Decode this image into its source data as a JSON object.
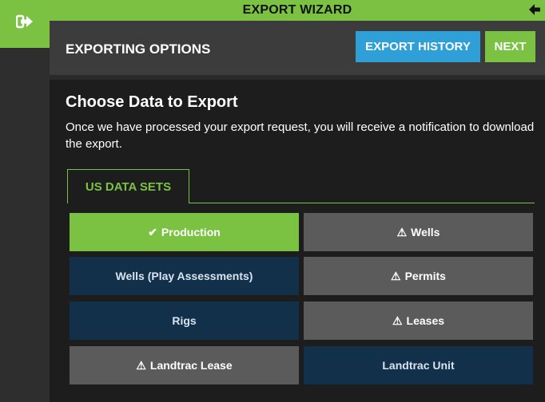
{
  "wizard": {
    "title": "EXPORT WIZARD",
    "back_glyph": "🡐"
  },
  "header": {
    "title": "EXPORTING OPTIONS",
    "export_history_label": "EXPORT HISTORY",
    "next_label": "NEXT"
  },
  "content": {
    "heading": "Choose Data to Export",
    "description": "Once we have processed your export request, you will receive a notification to download the export.",
    "tab_label": "US DATA SETS"
  },
  "datasets": [
    {
      "label": "Production",
      "state": "selected",
      "icon": "check-icon"
    },
    {
      "label": "Wells",
      "state": "warning",
      "icon": "warning-icon"
    },
    {
      "label": "Wells (Play Assessments)",
      "state": "available",
      "icon": ""
    },
    {
      "label": "Permits",
      "state": "warning",
      "icon": "warning-icon"
    },
    {
      "label": "Rigs",
      "state": "available",
      "icon": ""
    },
    {
      "label": "Leases",
      "state": "warning",
      "icon": "warning-icon"
    },
    {
      "label": "Landtrac Lease",
      "state": "warning",
      "icon": "warning-icon"
    },
    {
      "label": "Landtrac Unit",
      "state": "available",
      "icon": ""
    }
  ],
  "colors": {
    "accent_green": "#7cc242",
    "history_blue": "#2f9fd8",
    "tile_navy": "#12304a",
    "tile_grey": "#5b5b5b"
  }
}
